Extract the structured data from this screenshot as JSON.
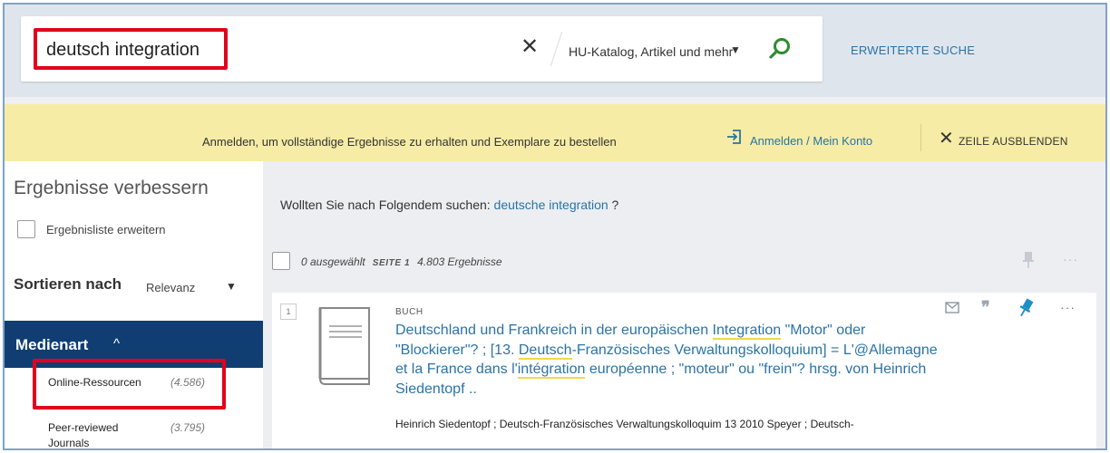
{
  "search": {
    "query": "deutsch integration",
    "clear_symbol": "✕",
    "scope": "HU-Katalog, Artikel und mehr",
    "advanced_label": "ERWEITERTE SUCHE"
  },
  "login_banner": {
    "message": "Anmelden, um vollständige Ergebnisse zu erhalten und Exemplare zu bestellen",
    "login_link": "Anmelden / Mein Konto",
    "hide_label": "ZEILE AUSBLENDEN"
  },
  "sidebar": {
    "title": "Ergebnisse verbessern",
    "expand_label": "Ergebnisliste erweitern",
    "sort_label": "Sortieren nach",
    "sort_value": "Relevanz",
    "media_heading": "Medienart",
    "facets": [
      {
        "name": "Online-Ressourcen",
        "count": "(4.586)"
      },
      {
        "name": "Peer-reviewed Journals",
        "count": "(3.795)"
      }
    ]
  },
  "results": {
    "did_you_mean_prefix": "Wollten Sie nach Folgendem suchen:",
    "did_you_mean_suggestion": "deutsche integration",
    "did_you_mean_suffix": "?",
    "selected": "0 ausgewählt",
    "page": "SEITE 1",
    "count": "4.803 Ergebnisse",
    "items": [
      {
        "number": "1",
        "type": "BUCH",
        "title_parts": [
          "Deutschland und Frankreich in der europäischen ",
          "Integration",
          " \"Motor\" oder \"Blockierer\"? ; [13. ",
          "Deutsch",
          "-Französisches Verwaltungskolloquium] = L'@Allemagne et la France dans l'",
          "intégration",
          " européenne ; \"moteur\" ou \"frein\"? hrsg. von Heinrich Siedentopf .."
        ],
        "authors_parts": [
          "Heinrich Siedentopf ; ",
          "Deutsch",
          "-Französisches Verwaltungskolloquim 13 2010 Speyer ; ",
          "Deutsch",
          "-"
        ]
      }
    ]
  },
  "icons": {
    "search": "search-icon",
    "login": "login-icon",
    "mail": "email-icon",
    "cite": "citation-icon",
    "pin": "pin-icon",
    "more": "more-icon"
  },
  "colors": {
    "accent_blue": "#2a73a6",
    "facet_header": "#103e73",
    "banner": "#f6eca5",
    "highlight_red": "#e3001b",
    "search_green": "#2e8b2e",
    "pin_blue": "#1f8fc7"
  }
}
